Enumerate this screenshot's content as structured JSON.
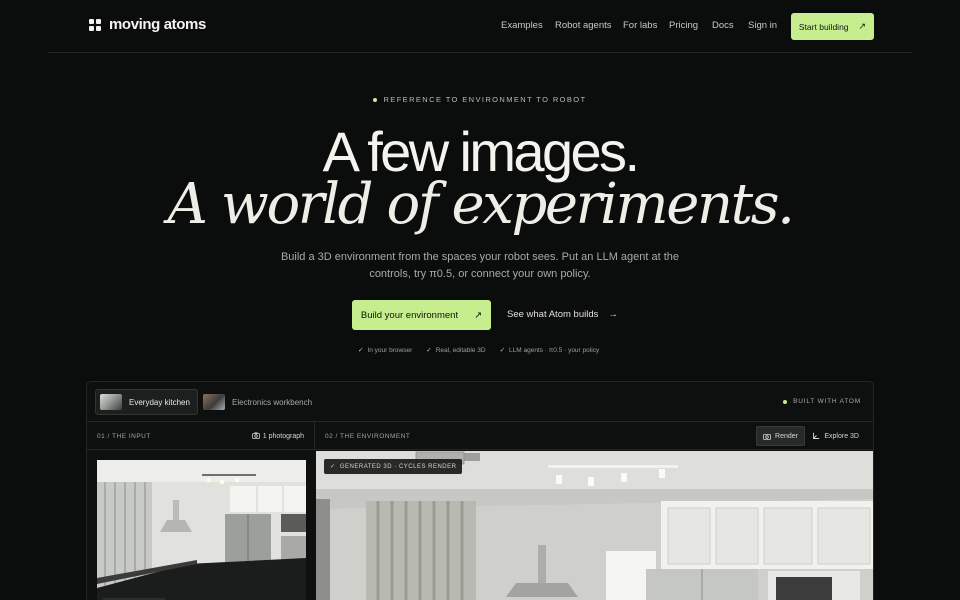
{
  "brand": {
    "name": "moving atoms"
  },
  "nav": {
    "links": [
      "Examples",
      "Robot agents",
      "For labs",
      "Pricing",
      "Docs",
      "Sign in"
    ],
    "cta": "Start building"
  },
  "hero": {
    "eyebrow": "REFERENCE TO ENVIRONMENT TO ROBOT",
    "headline_1": "A few images.",
    "headline_2": "A world of experiments.",
    "subhead": "Build a 3D environment from the spaces your robot sees. Put an LLM agent at the controls, try π0.5, or connect your own policy.",
    "primary_cta": "Build your environment",
    "secondary_cta": "See what Atom builds",
    "checks": [
      "In your browser",
      "Real, editable 3D",
      "LLM agents · π0.5 · your policy"
    ]
  },
  "demo": {
    "tabs": [
      {
        "label": "Everyday kitchen",
        "active": true
      },
      {
        "label": "Electronics workbench",
        "active": false
      }
    ],
    "built_with": "BUILT WITH ATOM",
    "input": {
      "title": "01 / THE INPUT",
      "meta": "1 photograph"
    },
    "environment": {
      "title": "02 / THE ENVIRONMENT",
      "modes": [
        "Render",
        "Explore 3D"
      ],
      "active_mode": "Render",
      "badge": "GENERATED 3D · CYCLES RENDER"
    }
  },
  "colors": {
    "accent": "#c6ee8e",
    "background": "#0b0c0c"
  },
  "icons": [
    "grid-logo-icon",
    "arrow-up-right-icon",
    "arrow-right-icon",
    "check-icon",
    "camera-icon",
    "axes-icon"
  ]
}
